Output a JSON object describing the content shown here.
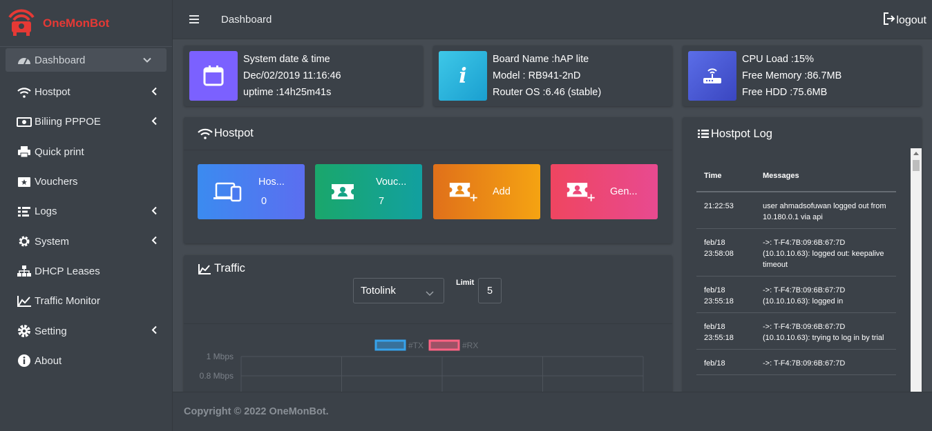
{
  "brand": {
    "name": "OneMonBot",
    "color": "#e53935"
  },
  "sidebar": {
    "items": [
      {
        "label": "Dashboard",
        "icon": "dashboard-icon",
        "chevron": "down"
      },
      {
        "label": "Hostpot",
        "icon": "wifi-icon",
        "chevron": "left"
      },
      {
        "label": "Biliing PPPOE",
        "icon": "money-icon",
        "chevron": "left"
      },
      {
        "label": "Quick print",
        "icon": "print-icon",
        "chevron": ""
      },
      {
        "label": "Vouchers",
        "icon": "ticket-icon",
        "chevron": ""
      },
      {
        "label": "Logs",
        "icon": "list-icon",
        "chevron": "left"
      },
      {
        "label": "System",
        "icon": "gear-icon",
        "chevron": "left"
      },
      {
        "label": "DHCP Leases",
        "icon": "sitemap-icon",
        "chevron": ""
      },
      {
        "label": "Traffic Monitor",
        "icon": "area-chart-icon",
        "chevron": ""
      },
      {
        "label": "Setting",
        "icon": "cog-icon",
        "chevron": "left"
      },
      {
        "label": "About",
        "icon": "info-icon",
        "chevron": ""
      }
    ]
  },
  "topbar": {
    "title": "Dashboard",
    "logout_label": "logout"
  },
  "info_boxes": {
    "datetime": {
      "line1": "System date & time",
      "line2": "Dec/02/2019 11:16:46",
      "line3": "uptime :14h25m41s",
      "color": "#7b61ff"
    },
    "board": {
      "line1": "Board Name :hAP lite",
      "line2": "Model : RB941-2nD",
      "line3": "Router OS :6.46 (stable)",
      "color": "#2bb6e0"
    },
    "resources": {
      "line1": "CPU Load :15%",
      "line2": "Free Memory :86.7MB",
      "line3": "Free HDD :75.6MB",
      "color": "#4a5ad8"
    }
  },
  "hostpot_card": {
    "title": "Hostpot",
    "tiles": [
      {
        "label": "Hos...",
        "value": "0",
        "icon": "devices-icon"
      },
      {
        "label": "Vouc...",
        "value": "7",
        "icon": "ticket-icon"
      },
      {
        "label": "Add",
        "value": "",
        "icon": "add-ticket-icon"
      },
      {
        "label": "Gen...",
        "value": "",
        "icon": "generate-ticket-icon"
      }
    ]
  },
  "traffic_card": {
    "title": "Traffic",
    "interface": "Totolink",
    "limit_label": "Limit",
    "limit_value": "5"
  },
  "chart_data": {
    "type": "line",
    "series": [
      {
        "name": "#TX",
        "color": "#36a2eb",
        "values": []
      },
      {
        "name": "#RX",
        "color": "#ff6384",
        "values": []
      }
    ],
    "y_ticks": [
      "1 Mbps",
      "0.8 Mbps"
    ],
    "grid": true,
    "legend": "top"
  },
  "log_card": {
    "title": "Hostpot Log",
    "headers": [
      "Time",
      "Messages"
    ],
    "rows": [
      {
        "time": "21:22:53",
        "msg": "user ahmadsofuwan logged out from 10.180.0.1 via api"
      },
      {
        "time": "feb/18 23:58:08",
        "msg": "->: T-F4:7B:09:6B:67:7D (10.10.10.63): logged out: keepalive timeout"
      },
      {
        "time": "feb/18 23:55:18",
        "msg": "->: T-F4:7B:09:6B:67:7D (10.10.10.63): logged in"
      },
      {
        "time": "feb/18 23:55:18",
        "msg": "->: T-F4:7B:09:6B:67:7D (10.10.10.63): trying to log in by trial"
      },
      {
        "time": "feb/18",
        "msg": "->: T-F4:7B:09:6B:67:7D"
      }
    ]
  },
  "footer": {
    "text": "Copyright © 2022 OneMonBot."
  }
}
